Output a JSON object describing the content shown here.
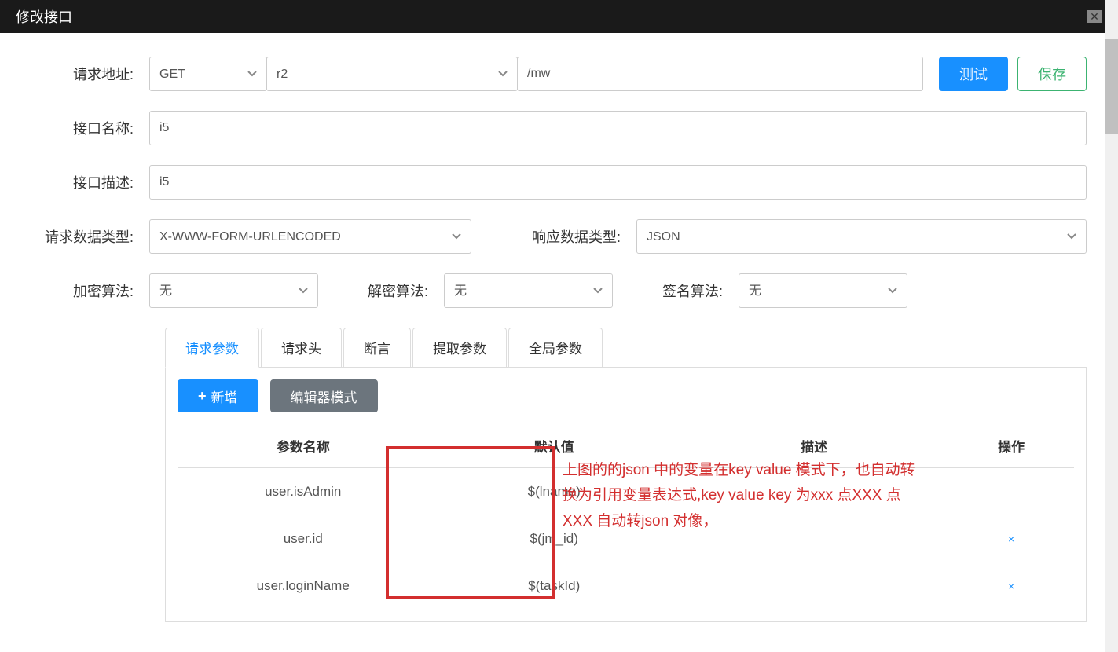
{
  "header": {
    "title": "修改接口"
  },
  "form": {
    "url_label": "请求地址:",
    "method": "GET",
    "host": "r2",
    "path": "/mw",
    "test_btn": "测试",
    "save_btn": "保存",
    "name_label": "接口名称:",
    "name_value": "i5",
    "desc_label": "接口描述:",
    "desc_value": "i5",
    "req_type_label": "请求数据类型:",
    "req_type_value": "X-WWW-FORM-URLENCODED",
    "resp_type_label": "响应数据类型:",
    "resp_type_value": "JSON",
    "encrypt_label": "加密算法:",
    "encrypt_value": "无",
    "decrypt_label": "解密算法:",
    "decrypt_value": "无",
    "sign_label": "签名算法:",
    "sign_value": "无"
  },
  "tabs": [
    "请求参数",
    "请求头",
    "断言",
    "提取参数",
    "全局参数"
  ],
  "toolbar": {
    "add_btn": "新增",
    "editor_btn": "编辑器模式"
  },
  "table": {
    "headers": [
      "参数名称",
      "默认值",
      "描述",
      "操作"
    ],
    "rows": [
      {
        "name": "user.isAdmin",
        "default": "$(lname)",
        "desc": "",
        "op": ""
      },
      {
        "name": "user.id",
        "default": "$(jm_id)",
        "desc": "",
        "op": "×"
      },
      {
        "name": "user.loginName",
        "default": "$(taskId)",
        "desc": "",
        "op": "×"
      }
    ]
  },
  "annotation": "上图的的json 中的变量在key value 模式下，也自动转换为引用变量表达式,key value key 为xxx 点XXX 点XXX 自动转json 对像，"
}
